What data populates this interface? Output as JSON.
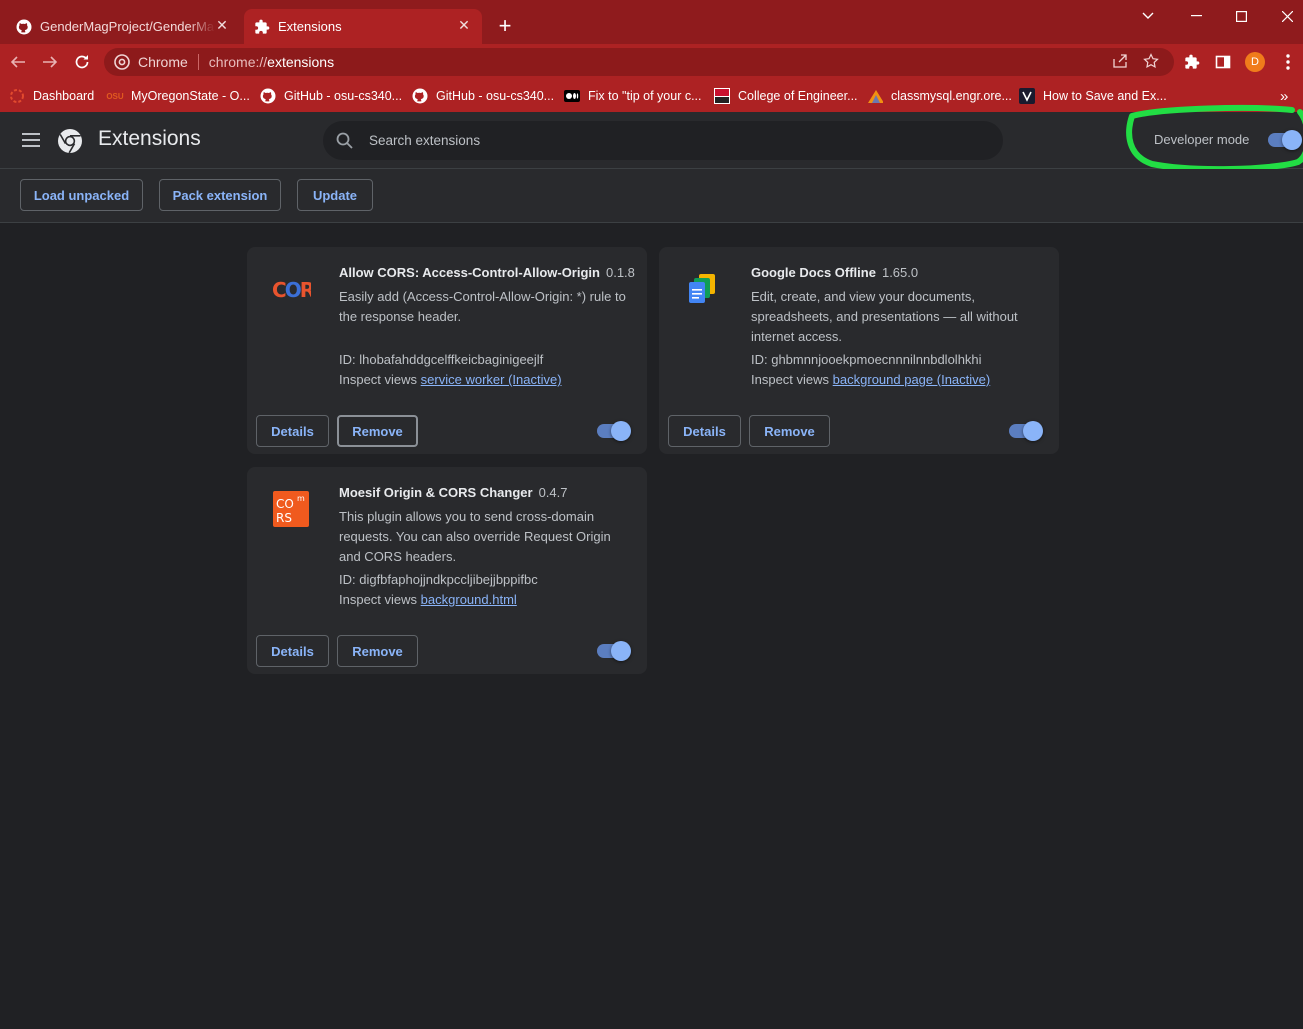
{
  "browser": {
    "tabs": [
      {
        "title": "GenderMagProject/GenderMagR",
        "icon": "github-icon",
        "active": false
      },
      {
        "title": "Extensions",
        "icon": "puzzle-icon",
        "active": true
      }
    ],
    "omnibox": {
      "site_label": "Chrome",
      "url_prefix": "chrome://",
      "url_path": "extensions"
    },
    "profile_initial": "D",
    "bookmarks": [
      {
        "label": "Dashboard",
        "icon": "canvas-icon"
      },
      {
        "label": "MyOregonState - O...",
        "icon": "osu-icon"
      },
      {
        "label": "GitHub - osu-cs340...",
        "icon": "github-icon"
      },
      {
        "label": "GitHub - osu-cs340...",
        "icon": "github-icon"
      },
      {
        "label": "Fix to \"tip of your c...",
        "icon": "medium-icon"
      },
      {
        "label": "College of Engineer...",
        "icon": "coe-icon"
      },
      {
        "label": "classmysql.engr.ore...",
        "icon": "phpmyadmin-icon"
      },
      {
        "label": "How to Save and Ex...",
        "icon": "vim-icon"
      }
    ]
  },
  "extensions_page": {
    "title": "Extensions",
    "search_placeholder": "Search extensions",
    "developer_mode_label": "Developer mode",
    "developer_mode_on": true,
    "actions": {
      "load_unpacked": "Load unpacked",
      "pack_extension": "Pack extension",
      "update": "Update"
    },
    "cards": [
      {
        "name": "Allow CORS: Access-Control-Allow-Origin",
        "version": "0.1.8",
        "description": "Easily add (Access-Control-Allow-Origin: *) rule to the response header.",
        "id": "ID: lhobafahddgcelffkeicbaginigeejlf",
        "inspect_label": "Inspect views",
        "inspect_link": "service worker (Inactive)",
        "details_label": "Details",
        "remove_label": "Remove",
        "enabled": true
      },
      {
        "name": "Google Docs Offline",
        "version": "1.65.0",
        "description": "Edit, create, and view your documents, spreadsheets, and presentations — all without internet access.",
        "id": "ID: ghbmnnjooekpmoecnnnilnnbdlolhkhi",
        "inspect_label": "Inspect views",
        "inspect_link": "background page (Inactive)",
        "details_label": "Details",
        "remove_label": "Remove",
        "enabled": true
      },
      {
        "name": "Moesif Origin & CORS Changer",
        "version": "0.4.7",
        "description": "This plugin allows you to send cross-domain requests. You can also override Request Origin and CORS headers.",
        "id": "ID: digfbfaphojjndkpccljibejjbppifbc",
        "inspect_label": "Inspect views",
        "inspect_link": "background.html",
        "details_label": "Details",
        "remove_label": "Remove",
        "enabled": true
      }
    ]
  },
  "colors": {
    "accent": "#8ab4f8",
    "toolbar": "#ad2223",
    "highlight": "#22dd44"
  }
}
